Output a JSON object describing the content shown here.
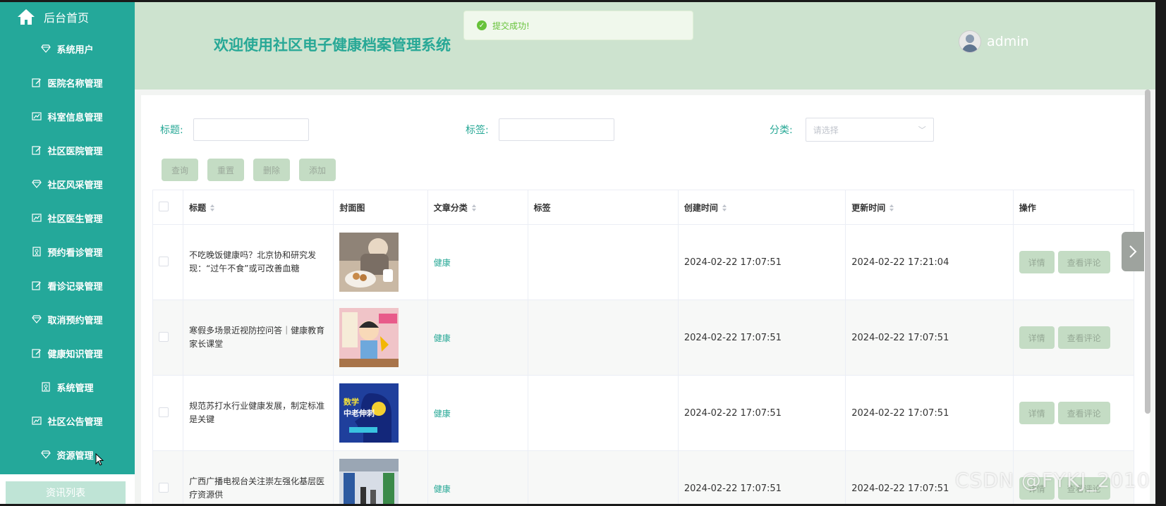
{
  "sidebar": {
    "home_label": "后台首页",
    "items": [
      {
        "label": "系统用户",
        "icon": "diamond-icon"
      },
      {
        "label": "医院名称管理",
        "icon": "edit-icon"
      },
      {
        "label": "科室信息管理",
        "icon": "chart-icon"
      },
      {
        "label": "社区医院管理",
        "icon": "edit-icon"
      },
      {
        "label": "社区风采管理",
        "icon": "diamond-icon"
      },
      {
        "label": "社区医生管理",
        "icon": "chart-icon"
      },
      {
        "label": "预约看诊管理",
        "icon": "badge-icon"
      },
      {
        "label": "看诊记录管理",
        "icon": "edit-icon"
      },
      {
        "label": "取消预约管理",
        "icon": "diamond-icon"
      },
      {
        "label": "健康知识管理",
        "icon": "edit-icon"
      },
      {
        "label": "系统管理",
        "icon": "badge-icon"
      },
      {
        "label": "社区公告管理",
        "icon": "chart-icon"
      },
      {
        "label": "资源管理",
        "icon": "diamond-icon"
      }
    ],
    "sub_item": "资讯列表"
  },
  "header": {
    "title": "欢迎使用社区电子健康档案管理系统",
    "username": "admin"
  },
  "toast": {
    "message": "提交成功!"
  },
  "filters": {
    "title_label": "标题:",
    "tag_label": "标签:",
    "category_label": "分类:",
    "category_placeholder": "请选择"
  },
  "buttons": {
    "query": "查询",
    "reset": "重置",
    "delete": "删除",
    "add": "添加"
  },
  "table": {
    "headers": {
      "title": "标题",
      "cover": "封面图",
      "category": "文章分类",
      "tags": "标签",
      "created": "创建时间",
      "updated": "更新时间",
      "actions": "操作"
    },
    "rows": [
      {
        "title": "不吃晚饭健康吗？北京协和研究发现：“过午不食”或可改善血糖",
        "category": "健康",
        "tags": "",
        "created": "2024-02-22 17:07:51",
        "updated": "2024-02-22 17:21:04",
        "detail": "详情",
        "comments": "查看评论"
      },
      {
        "title": "寒假多场景近视防控问答｜健康教育家长课堂",
        "category": "健康",
        "tags": "",
        "created": "2024-02-22 17:07:51",
        "updated": "2024-02-22 17:07:51",
        "detail": "详情",
        "comments": "查看评论"
      },
      {
        "title": "规范苏打水行业健康发展，制定标准是关键",
        "category": "健康",
        "tags": "",
        "created": "2024-02-22 17:07:51",
        "updated": "2024-02-22 17:07:51",
        "detail": "详情",
        "comments": "查看评论"
      },
      {
        "title": "广西广播电视台关注崇左强化基层医疗资源供",
        "category": "健康",
        "tags": "",
        "created": "2024-02-22 17:07:51",
        "updated": "2024-02-22 17:07:51",
        "detail": "详情",
        "comments": "查看评论"
      }
    ]
  },
  "watermark": "CSDN @FYKJ_2010",
  "colors": {
    "primary": "#24a89a",
    "header_bg": "#cde3cf",
    "button_bg": "#c4dcc4"
  }
}
